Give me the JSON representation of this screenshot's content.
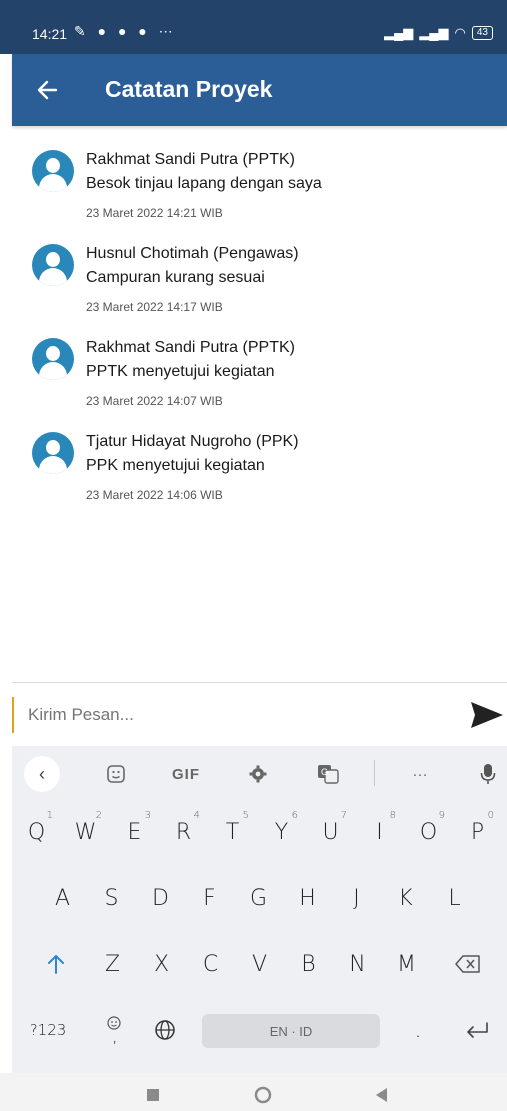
{
  "status_bar": {
    "time": "14:21",
    "battery": "43"
  },
  "app_bar": {
    "title": "Catatan Proyek"
  },
  "notes": [
    {
      "name": "Rakhmat Sandi Putra (PPTK)",
      "message": "Besok tinjau lapang dengan saya",
      "timestamp": "23 Maret 2022 14:21 WIB"
    },
    {
      "name": "Husnul Chotimah (Pengawas)",
      "message": "Campuran kurang sesuai",
      "timestamp": "23 Maret 2022 14:17 WIB"
    },
    {
      "name": "Rakhmat Sandi Putra (PPTK)",
      "message": "PPTK menyetujui kegiatan",
      "timestamp": "23 Maret 2022 14:07 WIB"
    },
    {
      "name": "Tjatur Hidayat Nugroho (PPK)",
      "message": "PPK menyetujui kegiatan",
      "timestamp": "23 Maret 2022 14:06 WIB"
    }
  ],
  "composer": {
    "placeholder": "Kirim Pesan...",
    "value": ""
  },
  "keyboard": {
    "toolbar": {
      "gif": "GIF",
      "more": "···"
    },
    "row1": [
      {
        "k": "Q",
        "n": "1"
      },
      {
        "k": "W",
        "n": "2"
      },
      {
        "k": "E",
        "n": "3"
      },
      {
        "k": "R",
        "n": "4"
      },
      {
        "k": "T",
        "n": "5"
      },
      {
        "k": "Y",
        "n": "6"
      },
      {
        "k": "U",
        "n": "7"
      },
      {
        "k": "I",
        "n": "8"
      },
      {
        "k": "O",
        "n": "9"
      },
      {
        "k": "P",
        "n": "0"
      }
    ],
    "row2": [
      "A",
      "S",
      "D",
      "F",
      "G",
      "H",
      "J",
      "K",
      "L"
    ],
    "row3": [
      "Z",
      "X",
      "C",
      "V",
      "B",
      "N",
      "M"
    ],
    "symbols_key": "?123",
    "space_label": "EN · ID",
    "period_key": ".",
    "comma_key": ","
  }
}
